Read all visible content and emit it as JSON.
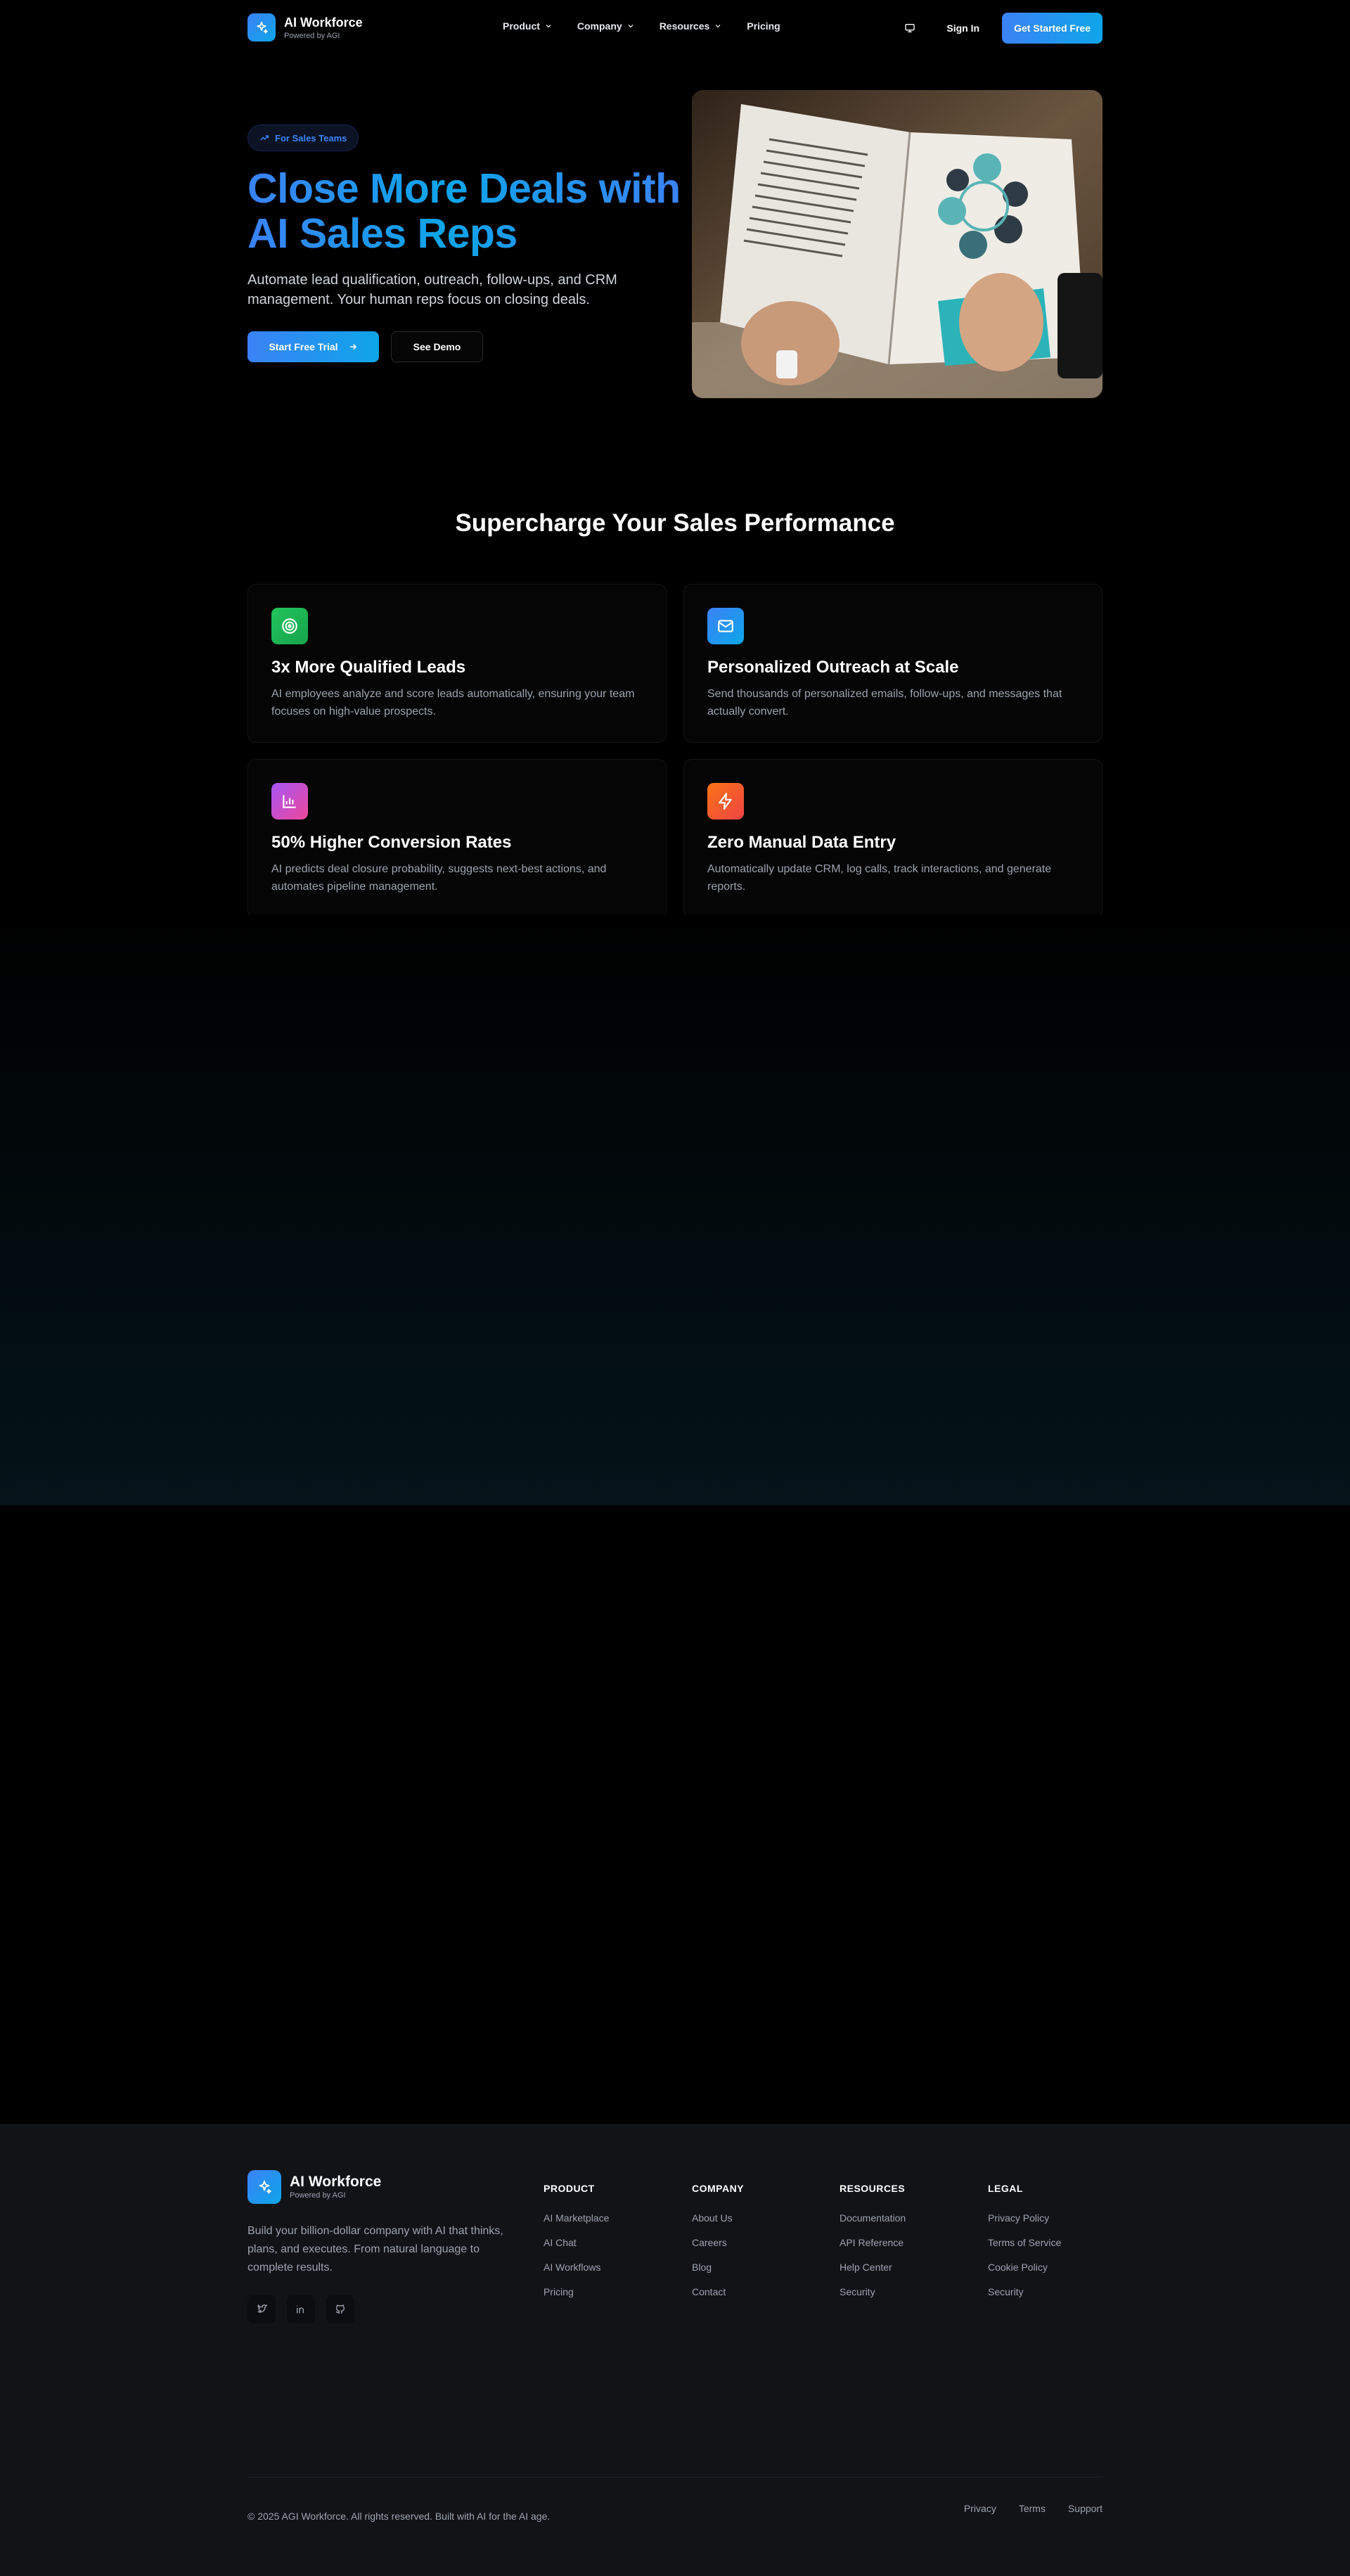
{
  "nav": {
    "brand_name": "AI Workforce",
    "brand_sub": "Powered by AGI",
    "links": [
      {
        "label": "Product",
        "dropdown": true
      },
      {
        "label": "Company",
        "dropdown": true
      },
      {
        "label": "Resources",
        "dropdown": true
      },
      {
        "label": "Pricing",
        "dropdown": false
      }
    ],
    "sign_in": "Sign In",
    "cta": "Get Started Free"
  },
  "hero": {
    "badge": "For Sales Teams",
    "title": "Close More Deals with AI Sales Reps",
    "description": "Automate lead qualification, outreach, follow-ups, and CRM management. Your human reps focus on closing deals.",
    "primary_button": "Start Free Trial",
    "secondary_button": "See Demo",
    "image_icon": "open-book-photo"
  },
  "features": {
    "title": "Supercharge Your Sales Performance",
    "cards": [
      {
        "title": "3x More Qualified Leads",
        "description": "AI employees analyze and score leads automatically, ensuring your team focuses on high-value prospects.",
        "icon": "target-icon",
        "color_from": "#22c55e",
        "color_to": "#16a34a"
      },
      {
        "title": "Personalized Outreach at Scale",
        "description": "Send thousands of personalized emails, follow-ups, and messages that actually convert.",
        "icon": "mail-icon",
        "color_from": "#3b82f6",
        "color_to": "#0ea5e9"
      },
      {
        "title": "50% Higher Conversion Rates",
        "description": "AI predicts deal closure probability, suggests next-best actions, and automates pipeline management.",
        "icon": "bar-chart-icon",
        "color_from": "#a855f7",
        "color_to": "#ec4899"
      },
      {
        "title": "Zero Manual Data Entry",
        "description": "Automatically update CRM, log calls, track interactions, and generate reports.",
        "icon": "lightning-icon",
        "color_from": "#f97316",
        "color_to": "#ef4444"
      }
    ]
  },
  "footer": {
    "brand_name": "AI Workforce",
    "brand_sub": "Powered by AGI",
    "description": "Build your billion-dollar company with AI that thinks, plans, and executes. From natural language to complete results.",
    "columns": [
      {
        "heading": "PRODUCT",
        "links": [
          "AI Marketplace",
          "AI Chat",
          "AI Workflows",
          "Pricing"
        ]
      },
      {
        "heading": "COMPANY",
        "links": [
          "About Us",
          "Careers",
          "Blog",
          "Contact"
        ]
      },
      {
        "heading": "RESOURCES",
        "links": [
          "Documentation",
          "API Reference",
          "Help Center",
          "Security"
        ]
      },
      {
        "heading": "LEGAL",
        "links": [
          "Privacy Policy",
          "Terms of Service",
          "Cookie Policy",
          "Security"
        ]
      }
    ],
    "copyright": "© 2025 AGI Workforce. All rights reserved. Built with AI for the AI age.",
    "bottom_links": [
      "Privacy",
      "Terms",
      "Support"
    ]
  }
}
